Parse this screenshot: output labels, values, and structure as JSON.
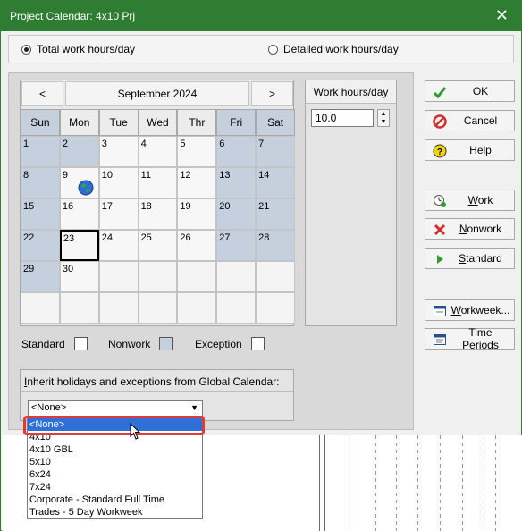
{
  "window": {
    "title": "Project Calendar: 4x10 Prj",
    "close_glyph": "✕"
  },
  "mode": {
    "options": [
      {
        "label": "Total work hours/day",
        "selected": true
      },
      {
        "label": "Detailed work hours/day",
        "selected": false
      }
    ]
  },
  "calendar": {
    "prev": "<",
    "next": ">",
    "month": "September 2024",
    "day_names": [
      "Sun",
      "Mon",
      "Tue",
      "Wed",
      "Thr",
      "Fri",
      "Sat"
    ],
    "today": 23,
    "holiday_icon_day": 9,
    "weeks": [
      [
        1,
        2,
        3,
        4,
        5,
        6,
        7
      ],
      [
        8,
        9,
        10,
        11,
        12,
        13,
        14
      ],
      [
        15,
        16,
        17,
        18,
        19,
        20,
        21
      ],
      [
        22,
        23,
        24,
        25,
        26,
        27,
        28
      ],
      [
        29,
        30,
        null,
        null,
        null,
        null,
        null
      ],
      [
        null,
        null,
        null,
        null,
        null,
        null,
        null
      ]
    ],
    "day_types": [
      [
        "nonwork",
        "nonwork",
        "standard",
        "standard",
        "standard",
        "nonwork",
        "nonwork"
      ],
      [
        "nonwork",
        "standard",
        "standard",
        "standard",
        "standard",
        "nonwork",
        "nonwork"
      ],
      [
        "nonwork",
        "standard",
        "standard",
        "standard",
        "standard",
        "nonwork",
        "nonwork"
      ],
      [
        "nonwork",
        "standard",
        "standard",
        "standard",
        "standard",
        "nonwork",
        "nonwork"
      ],
      [
        "nonwork",
        "standard",
        null,
        null,
        null,
        null,
        null
      ],
      [
        null,
        null,
        null,
        null,
        null,
        null,
        null
      ]
    ]
  },
  "work_hours": {
    "title": "Work hours/day",
    "value": "10.0"
  },
  "legend": {
    "standard": "Standard",
    "nonwork": "Nonwork",
    "exception": "Exception"
  },
  "inherit": {
    "label_prefix": "I",
    "label_rest": "nherit holidays and exceptions from Global Calendar:",
    "selected": "<None>",
    "options": [
      "<None>",
      "4x10",
      "4x10 GBL",
      "5x10",
      "6x24",
      "7x24",
      "Corporate - Standard Full Time",
      "Trades -  5 Day Workweek"
    ]
  },
  "buttons": {
    "ok": "OK",
    "cancel": "Cancel",
    "help": "Help",
    "work": {
      "u": "W",
      "rest": "ork"
    },
    "nonwork": {
      "u": "N",
      "rest": "onwork"
    },
    "standard": {
      "u": "S",
      "rest": "tandard"
    },
    "workweek": {
      "u": "W",
      "rest": "orkweek..."
    },
    "time_periods": "Time Periods"
  },
  "colors": {
    "title_bar": "#2e7d32",
    "nonwork_day": "#c4d0dd",
    "selected_item": "#2f6fd8",
    "highlight": "#e53935"
  }
}
